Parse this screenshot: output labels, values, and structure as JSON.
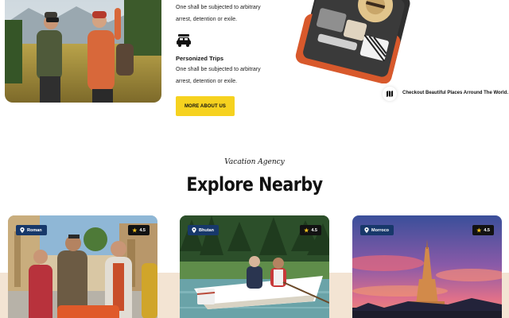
{
  "features": {
    "item1_text": "One shall be subjected to arbitrary arrest, detention or exile.",
    "item2_title": "Personized Trips",
    "item2_text": "One shall be subjected to arbitrary arrest, detention or exile.",
    "item2_icon": "car-icon"
  },
  "cta": {
    "more_about_us": "MORE ABOUT US"
  },
  "promo": {
    "checkout_text": "Checkout Beautiful Places Arround The World.",
    "icon": "map-icon"
  },
  "section": {
    "script_label": "Vacation Agency",
    "title": "Explore Nearby"
  },
  "cards": [
    {
      "location": "Roman",
      "rating": "4.5"
    },
    {
      "location": "Bhutan",
      "rating": "4.5"
    },
    {
      "location": "Morroco",
      "rating": "4.5"
    }
  ],
  "colors": {
    "accent_yellow": "#f6d21f",
    "badge_navy": "#17386a",
    "band_beige": "#f3e4d3"
  }
}
